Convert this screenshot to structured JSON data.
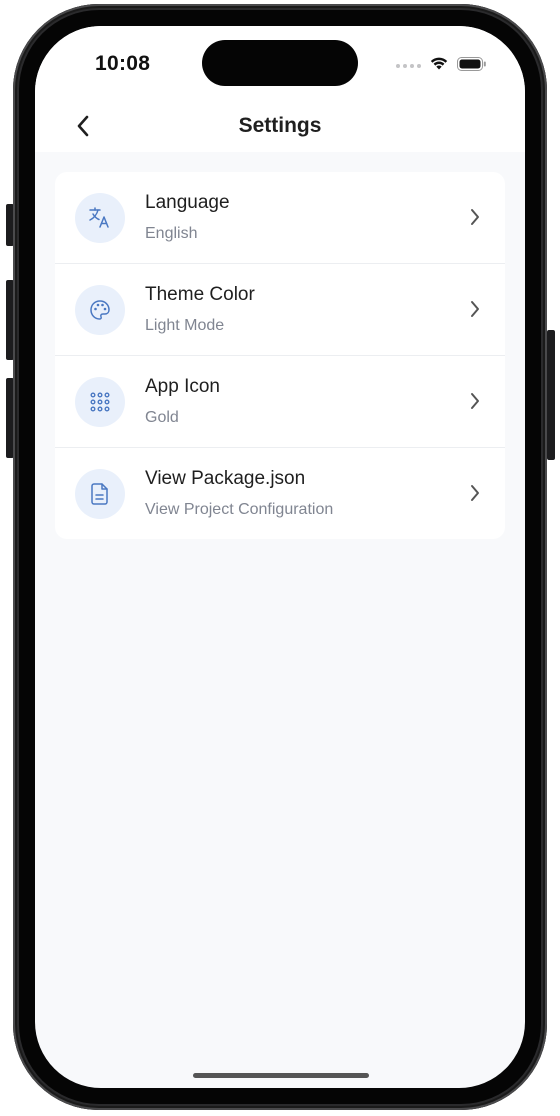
{
  "status_bar": {
    "time": "10:08"
  },
  "header": {
    "title": "Settings",
    "back_icon": "chevron-left-icon"
  },
  "settings": {
    "items": [
      {
        "title": "Language",
        "subtitle": "English",
        "icon": "translate-icon"
      },
      {
        "title": "Theme Color",
        "subtitle": "Light Mode",
        "icon": "palette-icon"
      },
      {
        "title": "App Icon",
        "subtitle": "Gold",
        "icon": "grid-dots-icon"
      },
      {
        "title": "View Package.json",
        "subtitle": "View Project Configuration",
        "icon": "document-icon"
      }
    ]
  },
  "colors": {
    "accent": "#4a78c2",
    "icon_background": "#e9f0fb",
    "screen_background": "#f8f9fb",
    "subtitle": "#808591"
  }
}
